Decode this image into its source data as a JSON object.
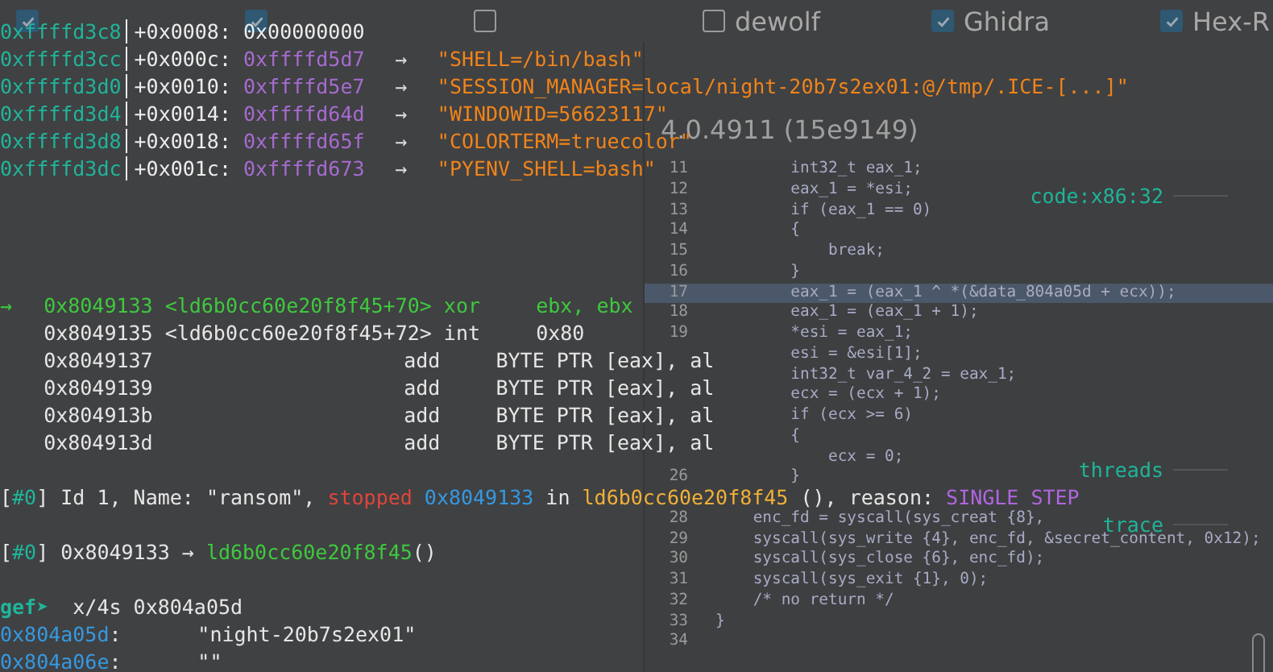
{
  "decompilers": [
    {
      "checked": true
    },
    {
      "checked": true
    },
    {
      "checked": false
    },
    {
      "label": "dewolf",
      "checked": false
    },
    {
      "label": "Ghidra",
      "checked": true
    },
    {
      "label": "Hex-R",
      "checked": true
    }
  ],
  "panels": [
    {
      "version": "4.0.4911 (15e9149)",
      "lines": [
        {
          "number": "11",
          "text": "        int32_t eax_1;",
          "selected": false
        },
        {
          "number": "12",
          "text": "        eax_1 = *esi;",
          "selected": false
        },
        {
          "number": "13",
          "text": "        if (eax_1 == 0)",
          "selected": false
        },
        {
          "number": "14",
          "text": "        {",
          "selected": false
        },
        {
          "number": "15",
          "text": "            break;",
          "selected": false
        },
        {
          "number": "16",
          "text": "        }",
          "selected": false
        },
        {
          "number": "17",
          "text": "        eax_1 = (eax_1 ^ *(&data_804a05d + ecx));",
          "selected": true
        },
        {
          "number": "18",
          "text": "        eax_1 = (eax_1 + 1);",
          "selected": false
        },
        {
          "number": "19",
          "text": "        *esi = eax_1;",
          "selected": false
        },
        {
          "text": "        esi = &esi[1];",
          "selected": false
        },
        {
          "text": "        int32_t var_4_2 = eax_1;",
          "selected": false
        },
        {
          "text": "        ecx = (ecx + 1);",
          "selected": false
        },
        {
          "text": "        if (ecx >= 6)",
          "selected": false
        },
        {
          "text": "        {",
          "selected": false
        },
        {
          "text": "            ecx = 0;",
          "selected": false
        },
        {
          "number": "26",
          "text": "        }",
          "selected": false
        },
        {
          "selected": false
        },
        {
          "number": "28",
          "text": "    enc_fd = syscall(sys_creat {8},",
          "selected": false
        },
        {
          "number": "29",
          "text": "    syscall(sys_write {4}, enc_fd, &secret_content, 0x12);",
          "selected": false
        },
        {
          "number": "30",
          "text": "    syscall(sys_close {6}, enc_fd);",
          "selected": false
        },
        {
          "number": "31",
          "text": "    syscall(sys_exit {1}, 0);",
          "selected": false
        },
        {
          "number": "32",
          "text": "    /* no return */",
          "selected": false
        },
        {
          "number": "33",
          "text": "}",
          "selected": false
        },
        {
          "number": "34",
          "selected": false
        }
      ]
    }
  ],
  "terminal": {
    "sections": [
      {
        "kind": "stack",
        "lines": [
          {
            "segments": [
              {
                "kind": "addr",
                "text": "0xffffd3c8"
              },
              {
                "kind": "offset",
                "text": "+0x0008:"
              },
              {
                "kind": "value",
                "text": "0x00000000"
              }
            ]
          },
          {
            "segments": [
              {
                "kind": "addr",
                "text": "0xffffd3cc"
              },
              {
                "kind": "offset",
                "text": "+0x000c:"
              },
              {
                "kind": "pointer",
                "text": "0xffffd5d7"
              },
              {
                "kind": "arrow",
                "text": "→"
              },
              {
                "kind": "string",
                "text": "\"SHELL=/bin/bash\""
              }
            ]
          },
          {
            "segments": [
              {
                "kind": "addr",
                "text": "0xffffd3d0"
              },
              {
                "kind": "offset",
                "text": "+0x0010:"
              },
              {
                "kind": "pointer",
                "text": "0xffffd5e7"
              },
              {
                "kind": "arrow",
                "text": "→"
              },
              {
                "kind": "string",
                "text": "\"SESSION_MANAGER=local/night-20b7s2ex01:@/tmp/.ICE-[...]\""
              }
            ]
          },
          {
            "segments": [
              {
                "kind": "addr",
                "text": "0xffffd3d4"
              },
              {
                "kind": "offset",
                "text": "+0x0014:"
              },
              {
                "kind": "pointer",
                "text": "0xffffd64d"
              },
              {
                "kind": "arrow",
                "text": "→"
              },
              {
                "kind": "string",
                "text": "\"WINDOWID=56623117\""
              }
            ]
          },
          {
            "segments": [
              {
                "kind": "addr",
                "text": "0xffffd3d8"
              },
              {
                "kind": "offset",
                "text": "+0x0018:"
              },
              {
                "kind": "pointer",
                "text": "0xffffd65f"
              },
              {
                "kind": "arrow",
                "text": "→"
              },
              {
                "kind": "string",
                "text": "\"COLORTERM=truecolor\""
              }
            ]
          },
          {
            "segments": [
              {
                "kind": "addr",
                "text": "0xffffd3dc"
              },
              {
                "kind": "offset",
                "text": "+0x001c:"
              },
              {
                "kind": "pointer",
                "text": "0xffffd673"
              },
              {
                "kind": "arrow",
                "text": "→"
              },
              {
                "kind": "string",
                "text": "\"PYENV_SHELL=bash\""
              }
            ]
          }
        ]
      },
      {
        "kind": "code",
        "header": "code:x86:32",
        "instructions": [
          {
            "current": true,
            "marker": "→",
            "address": "0x8049133",
            "symbol": "<ld6b0cc60e20f8f45+70>",
            "mnemonic": "xor",
            "operands": "ebx, ebx"
          },
          {
            "current": false,
            "address": "0x8049135",
            "symbol": "<ld6b0cc60e20f8f45+72>",
            "mnemonic": "int",
            "operands": "0x80"
          },
          {
            "current": false,
            "address": "0x8049137",
            "mnemonic": "add",
            "operands": "BYTE PTR [eax], al"
          },
          {
            "current": false,
            "address": "0x8049139",
            "mnemonic": "add",
            "operands": "BYTE PTR [eax], al"
          },
          {
            "current": false,
            "address": "0x804913b",
            "mnemonic": "add",
            "operands": "BYTE PTR [eax], al"
          },
          {
            "current": false,
            "address": "0x804913d",
            "mnemonic": "add",
            "operands": "BYTE PTR [eax], al"
          }
        ]
      },
      {
        "kind": "threads",
        "header": "threads",
        "lines": [
          {
            "segments": [
              {
                "kind": "plain",
                "text": "["
              },
              {
                "kind": "tag",
                "text": "#0"
              },
              {
                "kind": "plain",
                "text": "] Id 1, Name: \"ransom\", "
              },
              {
                "kind": "stopped",
                "text": "stopped"
              },
              {
                "kind": "location",
                "text": "0x8049133"
              },
              {
                "kind": "plain",
                "text": " in "
              },
              {
                "kind": "function",
                "text": "ld6b0cc60e20f8f45"
              },
              {
                "kind": "plain",
                "text": " (), reason: "
              },
              {
                "kind": "reason",
                "text": "SINGLE STEP"
              }
            ]
          }
        ]
      },
      {
        "kind": "trace",
        "header": "trace",
        "lines": [
          {
            "segments": [
              {
                "kind": "plain",
                "text": "["
              },
              {
                "kind": "tag",
                "text": "#0"
              },
              {
                "kind": "plain",
                "text": "] 0x8049133 → "
              },
              {
                "kind": "symbol",
                "text": "ld6b0cc60e20f8f45"
              },
              {
                "kind": "plain",
                "text": "()"
              }
            ]
          }
        ]
      },
      {
        "kind": "prompt",
        "lines": [
          {
            "segments": [
              {
                "kind": "prompt",
                "text": "gef➤"
              },
              {
                "kind": "plain",
                "text": "  x/4s 0x804a05d"
              }
            ]
          },
          {
            "segments": [
              {
                "kind": "location",
                "text": "0x804a05d"
              },
              {
                "kind": "plain",
                "text": ":"
              },
              {
                "kind": "memory",
                "text": "\"night-20b7s2ex01\""
              }
            ]
          },
          {
            "segments": [
              {
                "kind": "location",
                "text": "0x804a06e"
              },
              {
                "kind": "plain",
                "text": ":"
              },
              {
                "kind": "memory",
                "text": "\"\""
              }
            ]
          }
        ]
      }
    ]
  }
}
